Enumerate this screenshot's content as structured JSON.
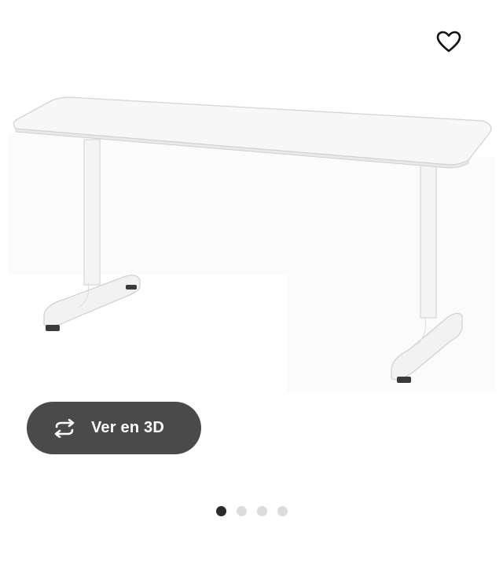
{
  "product": {
    "image_alt": "",
    "favorite_icon": "heart-outline-icon"
  },
  "view_3d": {
    "label": "Ver en 3D",
    "icon": "rotate-3d-icon"
  },
  "carousel": {
    "total": 4,
    "active_index": 0
  },
  "colors": {
    "button_bg": "#4a4a4a",
    "dot_active": "#2b2b2b",
    "dot_inactive": "#dcdcdc"
  }
}
